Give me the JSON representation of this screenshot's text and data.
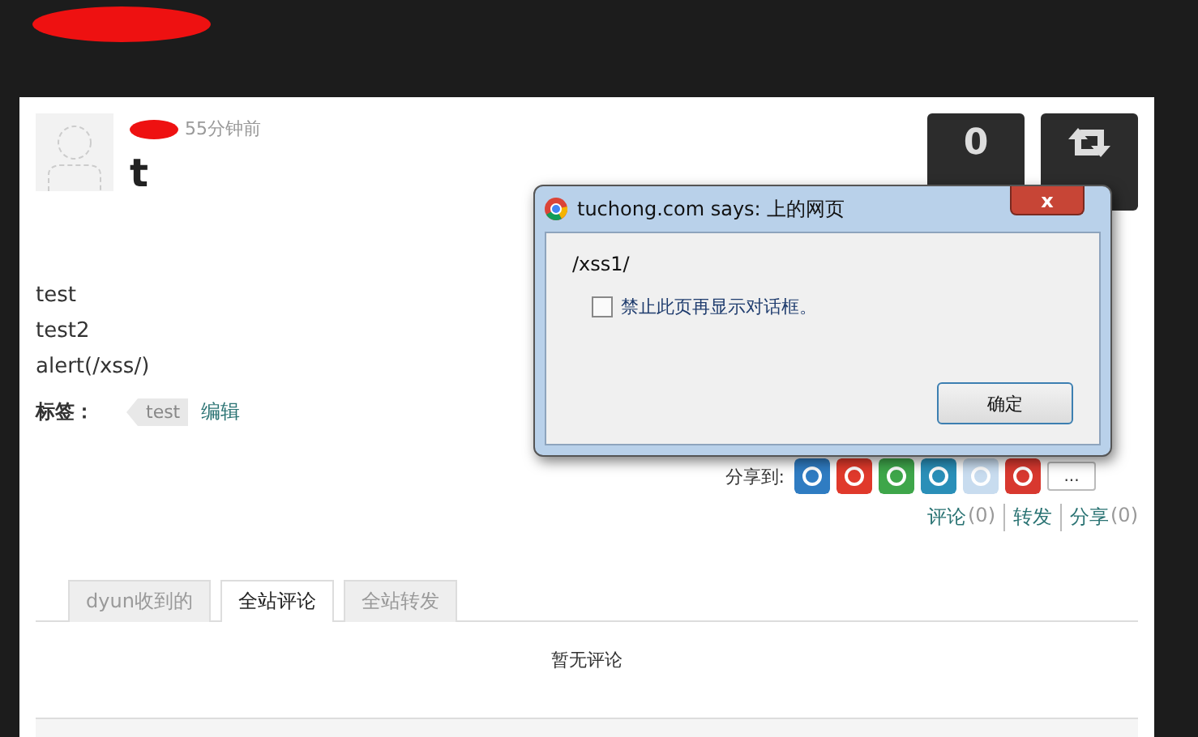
{
  "header": {
    "time": "55分钟前",
    "title": "t",
    "counter": "0"
  },
  "body_lines": [
    "test",
    "test2",
    "alert(/xss/)"
  ],
  "tags": {
    "label": "标签：",
    "items": [
      "test"
    ],
    "edit": "编辑"
  },
  "share": {
    "label": "分享到:",
    "services": [
      {
        "color": "#2f7cc2"
      },
      {
        "color": "#e0392b"
      },
      {
        "color": "#3ea64a"
      },
      {
        "color": "#2a8fb8"
      },
      {
        "color": "#c8dcef"
      },
      {
        "color": "#d8382f"
      }
    ],
    "more": "..."
  },
  "stats": [
    {
      "label": "评论",
      "count": "(0)"
    },
    {
      "label": "转发"
    },
    {
      "label": "分享",
      "count": "(0)"
    }
  ],
  "tabs": [
    {
      "label": "dyun收到的",
      "selected": false
    },
    {
      "label": "全站评论",
      "selected": true
    },
    {
      "label": "全站转发",
      "selected": false
    }
  ],
  "empty_message": "暂无评论",
  "dialog": {
    "title": "tuchong.com says: 上的网页",
    "close": "x",
    "message": "/xss1/",
    "checkbox": {
      "label": "禁止此页再显示对话框。",
      "checked": false
    },
    "button": "确定"
  }
}
